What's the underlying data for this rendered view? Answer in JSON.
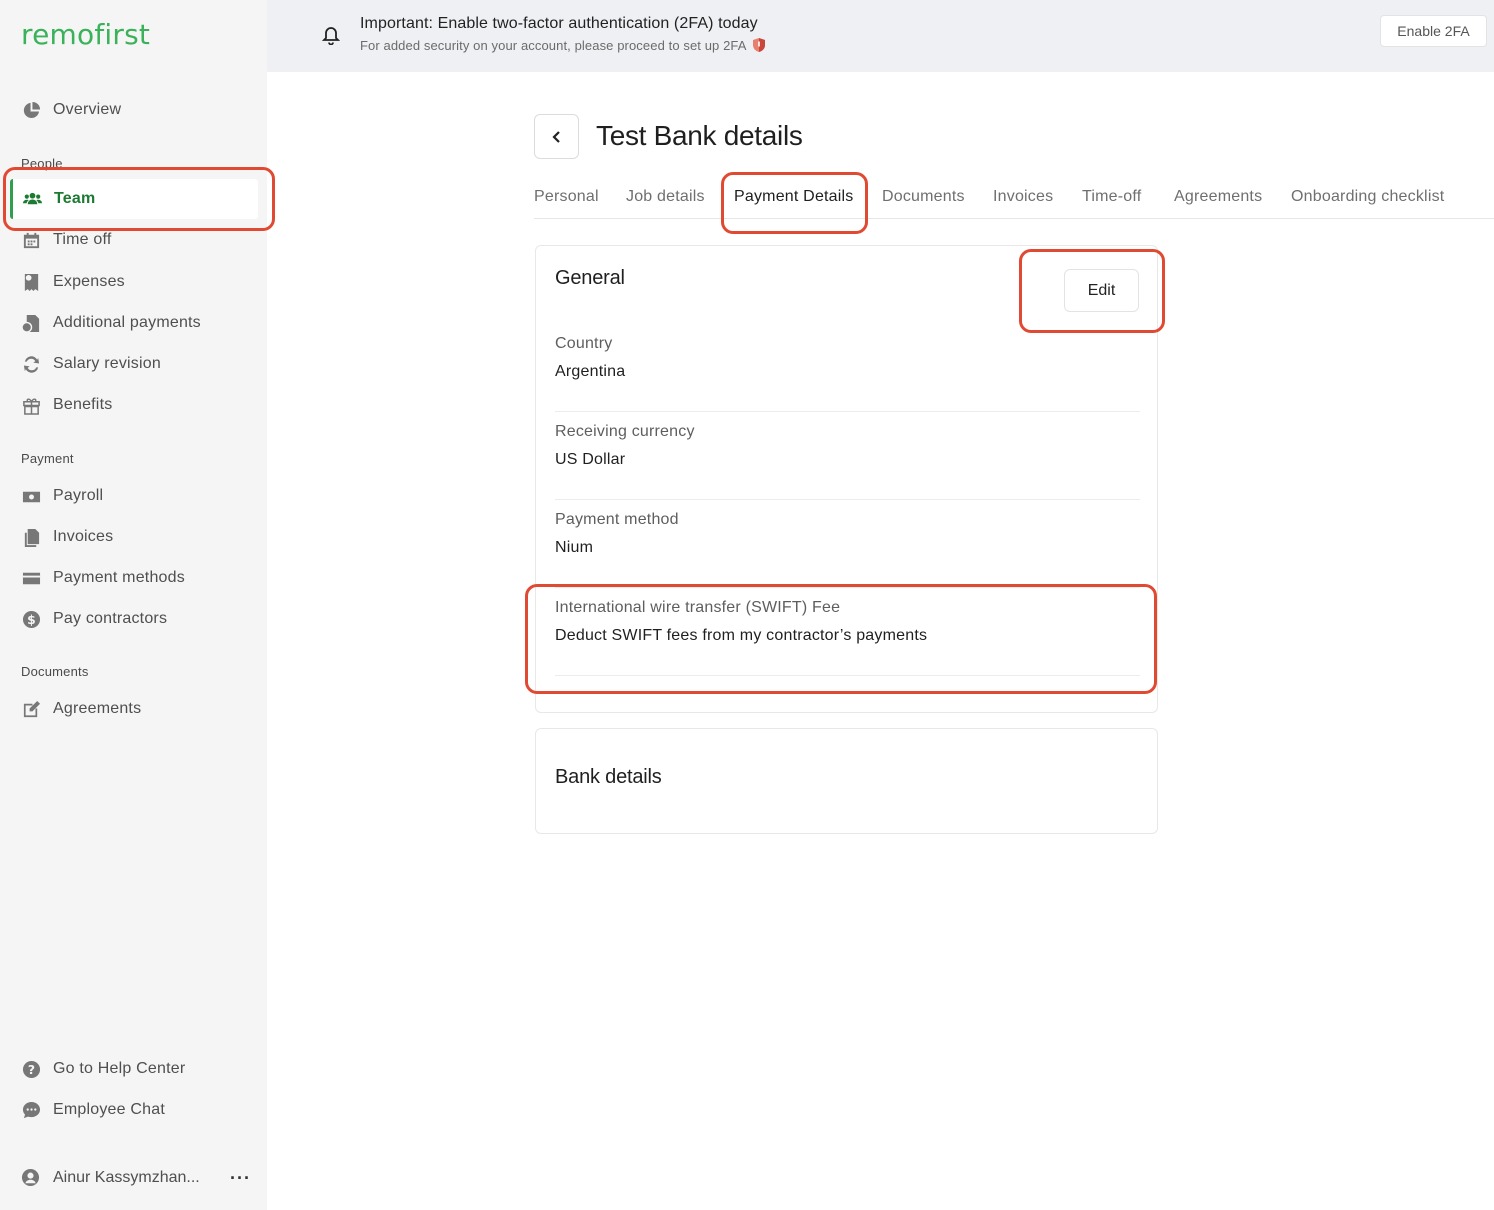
{
  "brand": {
    "logo_text": "remofirst",
    "logo_color": "#3bb25a"
  },
  "sidebar": {
    "overview": {
      "label": "Overview",
      "icon": "pie-chart-icon"
    },
    "sections": {
      "people": "People",
      "payment": "Payment",
      "documents": "Documents"
    },
    "people_items": [
      {
        "label": "Team",
        "icon": "team-icon",
        "active": true
      },
      {
        "label": "Time off",
        "icon": "calendar-icon"
      },
      {
        "label": "Expenses",
        "icon": "expenses-icon"
      },
      {
        "label": "Additional payments",
        "icon": "additional-payments-icon"
      },
      {
        "label": "Salary revision",
        "icon": "salary-revision-icon"
      },
      {
        "label": "Benefits",
        "icon": "gift-icon"
      }
    ],
    "payment_items": [
      {
        "label": "Payroll",
        "icon": "payroll-icon"
      },
      {
        "label": "Invoices",
        "icon": "invoices-icon"
      },
      {
        "label": "Payment methods",
        "icon": "credit-card-icon"
      },
      {
        "label": "Pay contractors",
        "icon": "dollar-icon"
      }
    ],
    "documents_items": [
      {
        "label": "Agreements",
        "icon": "edit-icon"
      }
    ],
    "footer": {
      "help": {
        "label": "Go to Help Center",
        "icon": "help-icon"
      },
      "chat": {
        "label": "Employee Chat",
        "icon": "chat-icon"
      },
      "user": {
        "name": "Ainur Kassymzhan...",
        "icon": "user-icon",
        "menu": "···"
      }
    }
  },
  "banner": {
    "title": "Important: Enable two-factor authentication (2FA) today",
    "subtitle": "For added security on your account, please proceed to set up 2FA",
    "button": "Enable 2FA"
  },
  "page": {
    "title": "Test Bank details",
    "tabs": [
      "Personal",
      "Job details",
      "Payment Details",
      "Documents",
      "Invoices",
      "Time-off",
      "Agreements",
      "Onboarding checklist"
    ],
    "active_tab": "Payment Details"
  },
  "general": {
    "title": "General",
    "edit_label": "Edit",
    "fields": [
      {
        "label": "Country",
        "value": "Argentina"
      },
      {
        "label": "Receiving currency",
        "value": "US Dollar"
      },
      {
        "label": "Payment method",
        "value": "Nium"
      },
      {
        "label": "International wire transfer (SWIFT) Fee",
        "value": "Deduct SWIFT fees from my contractor’s payments"
      }
    ]
  },
  "bank": {
    "title": "Bank details"
  },
  "colors": {
    "accent": "#2f9e4d",
    "highlight": "#e04a33",
    "banner_bg": "#eef0f3",
    "sidebar_bg": "#f5f5f5"
  }
}
